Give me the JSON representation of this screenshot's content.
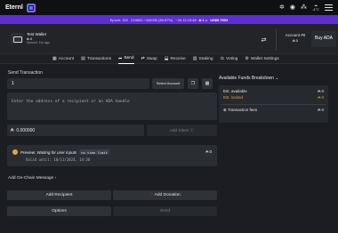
{
  "app": {
    "brand": "Eternl"
  },
  "topbar": {
    "icons": [
      "sync-icon",
      "eye-icon",
      "network-icon",
      "weather-icon",
      "menu-icon"
    ],
    "temp": "-4°C"
  },
  "epoch": {
    "label": "Epoch: 322",
    "slot": "219802 / 432000 (50.87%)",
    "time": "~2d 11:15:48",
    "rate_prefix": "₳ 1 =",
    "rate": "US$0.7503"
  },
  "wallet": {
    "name": "Test Wallet",
    "balance": "₳ 0",
    "synced": "Synced: 11s ago"
  },
  "account": {
    "title": "Account #0",
    "balance": "₳ 0"
  },
  "buy": {
    "label": "Buy ADA"
  },
  "tabs": [
    {
      "label": "Account",
      "icon": "account-icon"
    },
    {
      "label": "Transactions",
      "icon": "list-icon"
    },
    {
      "label": "Send",
      "icon": "send-icon",
      "active": true
    },
    {
      "label": "Swap",
      "icon": "swap-icon"
    },
    {
      "label": "Receive",
      "icon": "receive-icon"
    },
    {
      "label": "Staking",
      "icon": "staking-icon"
    },
    {
      "label": "Voting",
      "icon": "voting-icon"
    },
    {
      "label": "Wallet Settings",
      "icon": "gear-icon"
    }
  ],
  "send": {
    "title": "Send Transaction",
    "index": "1",
    "select_account": "Select Account",
    "address_placeholder": "Enter the address of a recipient or an ADA handle",
    "amount": "0.000000",
    "add_token": "Add Token"
  },
  "funds": {
    "title": "Available Funds Breakdown",
    "available_label": "Est. available",
    "available_value": "₳ 0",
    "locked_label": "Est. locked",
    "locked_value": "₳ 0",
    "fees_label": "Transaction fees",
    "fees_value": "₳ 0",
    "colors": {
      "locked": "#e8a33d"
    }
  },
  "preview": {
    "text": "Preview: Waiting for user inputs",
    "badge": "no time limit",
    "amount": "₳ 0",
    "valid_until": "Valid until: 10/11/2024, 14:30"
  },
  "onchain": {
    "label": "Add On-Chain Message"
  },
  "actions": {
    "add_recipient": "Add Recipient",
    "add_donation": "Add Donation",
    "options": "Options",
    "send": "Send"
  }
}
